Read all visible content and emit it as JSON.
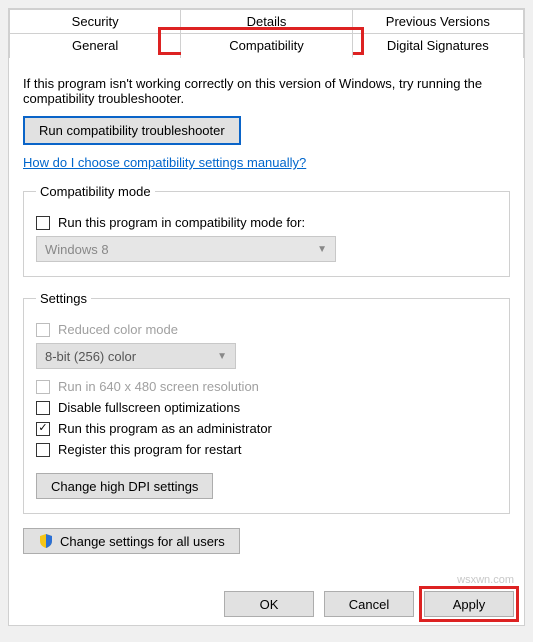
{
  "tabs": {
    "row1": [
      "Security",
      "Details",
      "Previous Versions"
    ],
    "row2": [
      "General",
      "Compatibility",
      "Digital Signatures"
    ],
    "active": "Compatibility"
  },
  "desc": "If this program isn't working correctly on this version of Windows, try running the compatibility troubleshooter.",
  "troubleshoot_btn": "Run compatibility troubleshooter",
  "manual_link": "How do I choose compatibility settings manually?",
  "compat_mode": {
    "legend": "Compatibility mode",
    "checkbox": "Run this program in compatibility mode for:",
    "combo": "Windows 8"
  },
  "settings": {
    "legend": "Settings",
    "reduced_color": "Reduced color mode",
    "color_combo": "8-bit (256) color",
    "lowres": "Run in 640 x 480 screen resolution",
    "disable_fullscreen": "Disable fullscreen optimizations",
    "run_admin": "Run this program as an administrator",
    "register_restart": "Register this program for restart",
    "dpi_btn": "Change high DPI settings"
  },
  "all_users_btn": "Change settings for all users",
  "buttons": {
    "ok": "OK",
    "cancel": "Cancel",
    "apply": "Apply"
  },
  "watermark": "wsxwn.com"
}
